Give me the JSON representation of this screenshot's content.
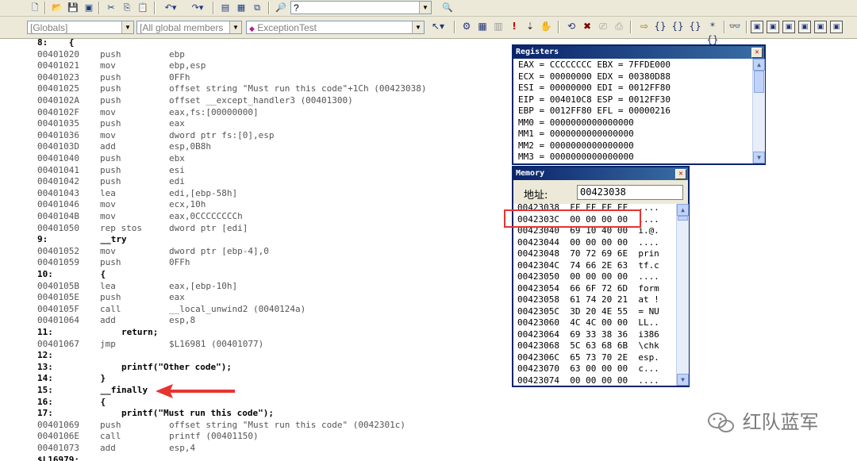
{
  "toolbar": {
    "find_text": "?",
    "combo_scope": "[Globals]",
    "combo_members": "[All global members",
    "combo_function": "ExceptionTest"
  },
  "code_lines": [
    {
      "src": "8:    {"
    },
    {
      "addr": "00401020",
      "op": "push",
      "arg": "ebp"
    },
    {
      "addr": "00401021",
      "op": "mov",
      "arg": "ebp,esp"
    },
    {
      "addr": "00401023",
      "op": "push",
      "arg": "0FFh"
    },
    {
      "addr": "00401025",
      "op": "push",
      "arg": "offset string \"Must run this code\"+1Ch (00423038)"
    },
    {
      "addr": "0040102A",
      "op": "push",
      "arg": "offset __except_handler3 (00401300)"
    },
    {
      "addr": "0040102F",
      "op": "mov",
      "arg": "eax,fs:[00000000]"
    },
    {
      "addr": "00401035",
      "op": "push",
      "arg": "eax"
    },
    {
      "addr": "00401036",
      "op": "mov",
      "arg": "dword ptr fs:[0],esp"
    },
    {
      "addr": "0040103D",
      "op": "add",
      "arg": "esp,0B8h"
    },
    {
      "addr": "00401040",
      "op": "push",
      "arg": "ebx"
    },
    {
      "addr": "00401041",
      "op": "push",
      "arg": "esi"
    },
    {
      "addr": "00401042",
      "op": "push",
      "arg": "edi"
    },
    {
      "addr": "00401043",
      "op": "lea",
      "arg": "edi,[ebp-58h]"
    },
    {
      "addr": "00401046",
      "op": "mov",
      "arg": "ecx,10h"
    },
    {
      "addr": "0040104B",
      "op": "mov",
      "arg": "eax,0CCCCCCCCh"
    },
    {
      "addr": "00401050",
      "op": "rep stos",
      "arg": "dword ptr [edi]"
    },
    {
      "src": "9:          __try"
    },
    {
      "addr": "00401052",
      "op": "mov",
      "arg": "dword ptr [ebp-4],0"
    },
    {
      "addr": "00401059",
      "op": "push",
      "arg": "0FFh"
    },
    {
      "src": "10:         {"
    },
    {
      "addr": "0040105B",
      "op": "lea",
      "arg": "eax,[ebp-10h]"
    },
    {
      "addr": "0040105E",
      "op": "push",
      "arg": "eax"
    },
    {
      "addr": "0040105F",
      "op": "call",
      "arg": "__local_unwind2 (0040124a)"
    },
    {
      "addr": "00401064",
      "op": "add",
      "arg": "esp,8"
    },
    {
      "src": "11:             return;"
    },
    {
      "addr": "00401067",
      "op": "jmp",
      "arg": "$L16981 (00401077)"
    },
    {
      "src": "12:"
    },
    {
      "src": "13:             printf(\"Other code\");"
    },
    {
      "src": "14:         }"
    },
    {
      "src": "15:         __finally"
    },
    {
      "src": "16:         {"
    },
    {
      "src": "17:             printf(\"Must run this code\");"
    },
    {
      "addr": "00401069",
      "op": "push",
      "arg": "offset string \"Must run this code\" (0042301c)"
    },
    {
      "addr": "0040106E",
      "op": "call",
      "arg": "printf (00401150)"
    },
    {
      "addr": "00401073",
      "op": "add",
      "arg": "esp,4"
    },
    {
      "src": "$L16979:"
    }
  ],
  "registers": {
    "title": "Registers",
    "lines": [
      "EAX = CCCCCCCC EBX = 7FFDE000",
      "ECX = 00000000 EDX = 00380D88",
      "ESI = 00000000 EDI = 0012FF80",
      "EIP = 004010C8 ESP = 0012FF30",
      "EBP = 0012FF80 EFL = 00000216",
      "MM0 = 0000000000000000",
      "MM1 = 0000000000000000",
      "MM2 = 0000000000000000",
      "MM3 = 0000000000000000"
    ]
  },
  "memory": {
    "title": "Memory",
    "address_label": "地址:",
    "address_value": "00423038",
    "lines": [
      "00423038  FF FF FF FF  ....",
      "0042303C  00 00 00 00  ....",
      "00423040  69 10 40 00  i.@.",
      "00423044  00 00 00 00  ....",
      "00423048  70 72 69 6E  prin",
      "0042304C  74 66 2E 63  tf.c",
      "00423050  00 00 00 00  ....",
      "00423054  66 6F 72 6D  form",
      "00423058  61 74 20 21  at !",
      "0042305C  3D 20 4E 55  = NU",
      "00423060  4C 4C 00 00  LL..",
      "00423064  69 33 38 36  i386",
      "00423068  5C 63 68 6B  \\chk",
      "0042306C  65 73 70 2E  esp.",
      "00423070  63 00 00 00  c...",
      "00423074  00 00 00 00  ...."
    ]
  },
  "watermark": "红队蓝军",
  "colors": {
    "highlight": "#e8332f",
    "titlebar": "#0a246a"
  }
}
